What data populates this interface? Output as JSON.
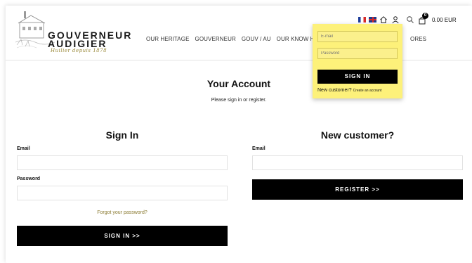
{
  "brand": {
    "name_line1": "GOUVERNEUR",
    "name_line2": "AUDIGIER",
    "tagline": "Huilier depuis 1878"
  },
  "nav": {
    "items": [
      {
        "label": "OUR HERITAGE"
      },
      {
        "label": "GOUVERNEUR"
      },
      {
        "label": "GOUV / AU"
      },
      {
        "label": "OUR KNOW H"
      },
      {
        "label": "ORES"
      }
    ]
  },
  "utility": {
    "flag_fr": "french-flag-icon",
    "flag_uk": "uk-flag-icon",
    "cart_count": "0",
    "cart_total": "0.00 EUR"
  },
  "account_dropdown": {
    "email_placeholder": "E-mail",
    "password_placeholder": "Password",
    "signin_label": "SIGN IN",
    "new_customer_text": "New customer?",
    "create_account_link": "Create an account"
  },
  "main": {
    "title": "Your Account",
    "subtitle": "Please sign in or register."
  },
  "signin": {
    "heading": "Sign In",
    "email_label": "Email",
    "email_value": "",
    "password_label": "Password",
    "password_value": "",
    "forgot_link": "Forgot your password?",
    "button_label": "SIGN IN >>"
  },
  "register": {
    "heading": "New customer?",
    "email_label": "Email",
    "email_value": "",
    "button_label": "REGISTER >>"
  },
  "colors": {
    "accent_gold": "#8a7a30",
    "dropdown_bg": "#fdf17a",
    "button_bg": "#000000"
  }
}
